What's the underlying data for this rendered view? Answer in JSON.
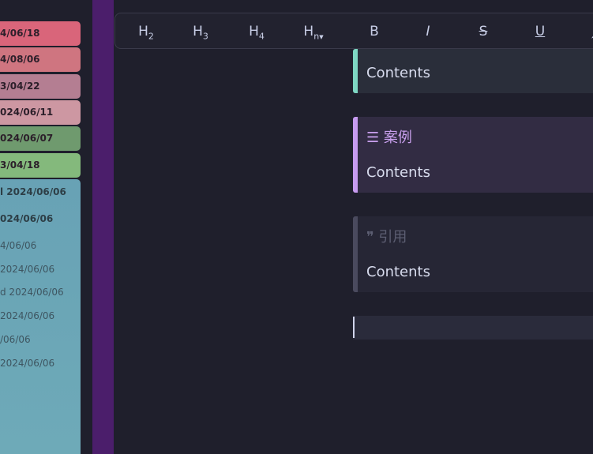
{
  "dates": [
    {
      "label": "4/06/18",
      "color": "#d9657a"
    },
    {
      "label": "4/08/06",
      "color": "#cf7580"
    },
    {
      "label": "3/04/22",
      "color": "#b47e92"
    },
    {
      "label": "024/06/11",
      "color": "#cd97a2"
    },
    {
      "label": "024/06/07",
      "color": "#6f9a6e"
    },
    {
      "label": "3/04/18",
      "color": "#84b97c"
    }
  ],
  "cyan_rows": [
    {
      "label": "l 2024/06/06",
      "bold": true
    },
    {
      "label": "024/06/06",
      "bold": true
    },
    {
      "label": "4/06/06",
      "bold": false
    },
    {
      "label": "2024/06/06",
      "bold": false
    },
    {
      "label": "d 2024/06/06",
      "bold": false
    },
    {
      "label": "2024/06/06",
      "bold": false
    },
    {
      "label": "/06/06",
      "bold": false
    },
    {
      "label": "2024/06/06",
      "bold": false
    }
  ],
  "toolbar": {
    "h2": "H",
    "h2_sub": "2",
    "h3": "H",
    "h3_sub": "3",
    "h4": "H",
    "h4_sub": "4",
    "hn": "H",
    "hn_sub": "n",
    "bold": "B",
    "italic": "I",
    "strike": "S",
    "underline": "U"
  },
  "callouts": {
    "first": {
      "body": "Contents"
    },
    "example": {
      "title": "☰ 案例",
      "body": "Contents"
    },
    "quote": {
      "title": "❞ 引用",
      "body": "Contents"
    }
  }
}
